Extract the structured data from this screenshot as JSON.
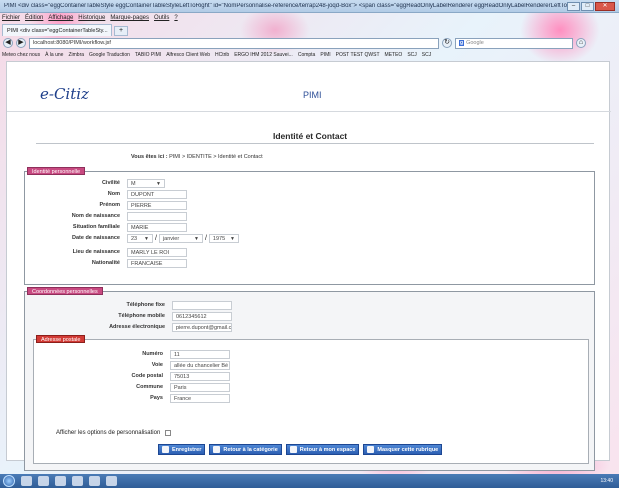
{
  "window": {
    "title": "PIMI <div class=\"eggContainerTableStyle eggContainerTableStyleLeftToRight\" id=\"NomPersonnalise-reference/terrap248-joqd-Box\"> <span class=\"eggReadOnlyLabelRenderer eggReadOnlyLabelRendererLeftToRight\" title=\"\" id=\"NomPersonnal... - Mozilla Firefox"
  },
  "menu": [
    "Fichier",
    "Édition",
    "Affichage",
    "Historique",
    "Marque-pages",
    "Outils",
    "?"
  ],
  "tab": {
    "label": "PIMI <div class=\"eggContainerTableSty...",
    "new_tab": "+"
  },
  "nav": {
    "url": "localhost:8080/PIMI/workflow.jsf",
    "search_placeholder": "Google"
  },
  "bookmarks": [
    "Meteo chez nous",
    "À la une",
    "Zimbra",
    "Google Traduction",
    "TABIO PIMI",
    "Alfresco Client Web",
    "HCtrib",
    "ERGO IHM 2012 Sauvei...",
    "Compta",
    "PIMI",
    "POST TEST QWST",
    "METEO",
    "SCJ",
    "SCJ"
  ],
  "header": {
    "logo": "e-Citiz",
    "app_title": "PIMI"
  },
  "page_title": "Identité et Contact",
  "breadcrumb": {
    "prefix": "Vous êtes ici :",
    "path": "PIMI > IDENTITE > Identité et Contact"
  },
  "identity": {
    "legend": "Identité personnelle",
    "civilite": {
      "label": "Civilité",
      "value": "M"
    },
    "nom": {
      "label": "Nom",
      "value": "DUPONT"
    },
    "prenom": {
      "label": "Prénom",
      "value": "PIERRE"
    },
    "nom_naissance": {
      "label": "Nom de naissance",
      "value": ""
    },
    "situation": {
      "label": "Situation familiale",
      "value": "MARIE"
    },
    "date": {
      "label": "Date de naissance",
      "day": "23",
      "month": "janvier",
      "year": "1975",
      "sep": "/"
    },
    "lieu": {
      "label": "Lieu de naissance",
      "value": "MARLY LE ROI"
    },
    "nationalite": {
      "label": "Nationalité",
      "value": "FRANCAISE"
    }
  },
  "contact": {
    "legend": "Coordonnées personnelles",
    "fixe": {
      "label": "Téléphone fixe",
      "value": ""
    },
    "mobile": {
      "label": "Téléphone mobile",
      "value": "0612345612"
    },
    "email": {
      "label": "Adresse électronique",
      "value": "pierre.dupont@gmail.c"
    }
  },
  "address": {
    "legend": "Adresse postale",
    "numero": {
      "label": "Numéro",
      "value": "11"
    },
    "voie": {
      "label": "Voie",
      "value": "allée du chancelier Bé"
    },
    "cp": {
      "label": "Code postal",
      "value": "75013"
    },
    "commune": {
      "label": "Commune",
      "value": "Paris"
    },
    "pays": {
      "label": "Pays",
      "value": "France"
    }
  },
  "options_label": "Afficher les options de personnalisation",
  "buttons": {
    "save": "Enregistrer",
    "back_category": "Retour à la catégorie",
    "back_space": "Retour à mon espace",
    "hide": "Masquer cette rubrique"
  },
  "taskbar": {
    "clock": "13:40"
  }
}
